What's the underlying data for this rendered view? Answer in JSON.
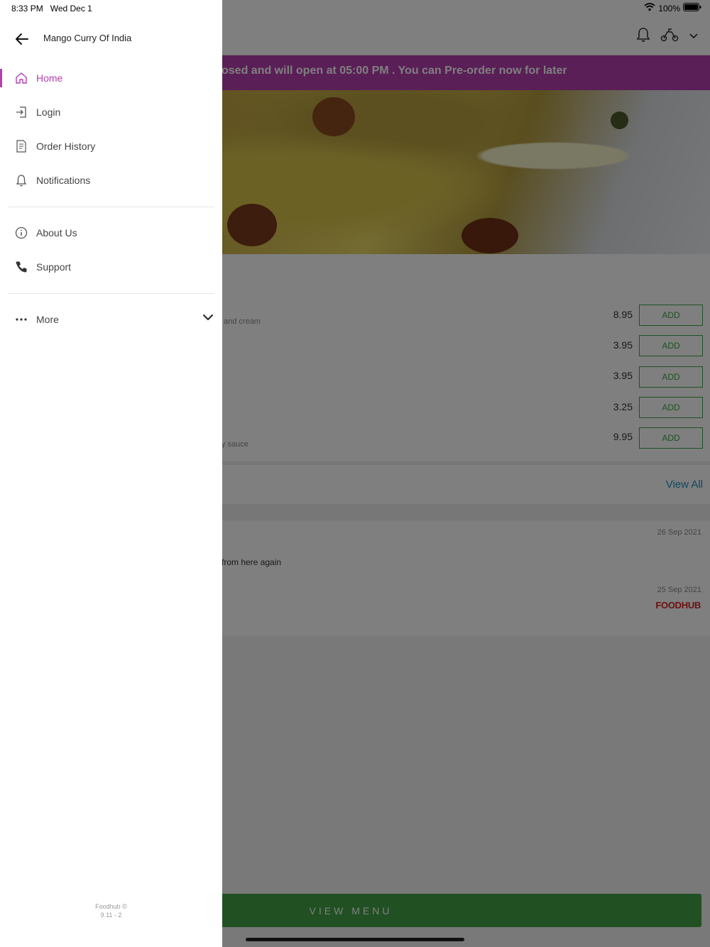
{
  "status_bar": {
    "time": "8:33 PM",
    "date": "Wed Dec 1",
    "battery": "100%"
  },
  "drawer": {
    "title": "Mango Curry Of India",
    "items": [
      {
        "label": "Home",
        "icon": "home-icon",
        "active": true
      },
      {
        "label": "Login",
        "icon": "login-icon"
      },
      {
        "label": "Order History",
        "icon": "receipt-icon"
      },
      {
        "label": "Notifications",
        "icon": "bell-icon"
      },
      {
        "label": "About Us",
        "icon": "info-icon"
      },
      {
        "label": "Support",
        "icon": "phone-icon"
      },
      {
        "label": "More",
        "icon": "more-icon"
      }
    ],
    "footer_line1": "Foodhub ©",
    "footer_line2": "9.11 - 2"
  },
  "background": {
    "banner": "osed and will open at 05:00 PM . You can Pre-order now for later",
    "menu_items": [
      {
        "desc": "and cream",
        "price": "8.95",
        "button": "ADD"
      },
      {
        "desc": "",
        "price": "3.95",
        "button": "ADD"
      },
      {
        "desc": "",
        "price": "3.95",
        "button": "ADD"
      },
      {
        "desc": "",
        "price": "3.25",
        "button": "ADD"
      },
      {
        "desc": "y sauce",
        "price": "9.95",
        "button": "ADD"
      }
    ],
    "view_all": "View All",
    "reviews": [
      {
        "date": "26 Sep 2021",
        "text": "from here again"
      },
      {
        "date": "25 Sep 2021",
        "text": ""
      }
    ],
    "brand_logo": "FOODHUB",
    "view_menu": "VIEW MENU"
  },
  "colors": {
    "accent": "#b43fae",
    "add_green": "#3ca34a",
    "view_menu_green": "#43a047",
    "link_blue": "#1a8fc4",
    "brand_red": "#d92323"
  }
}
